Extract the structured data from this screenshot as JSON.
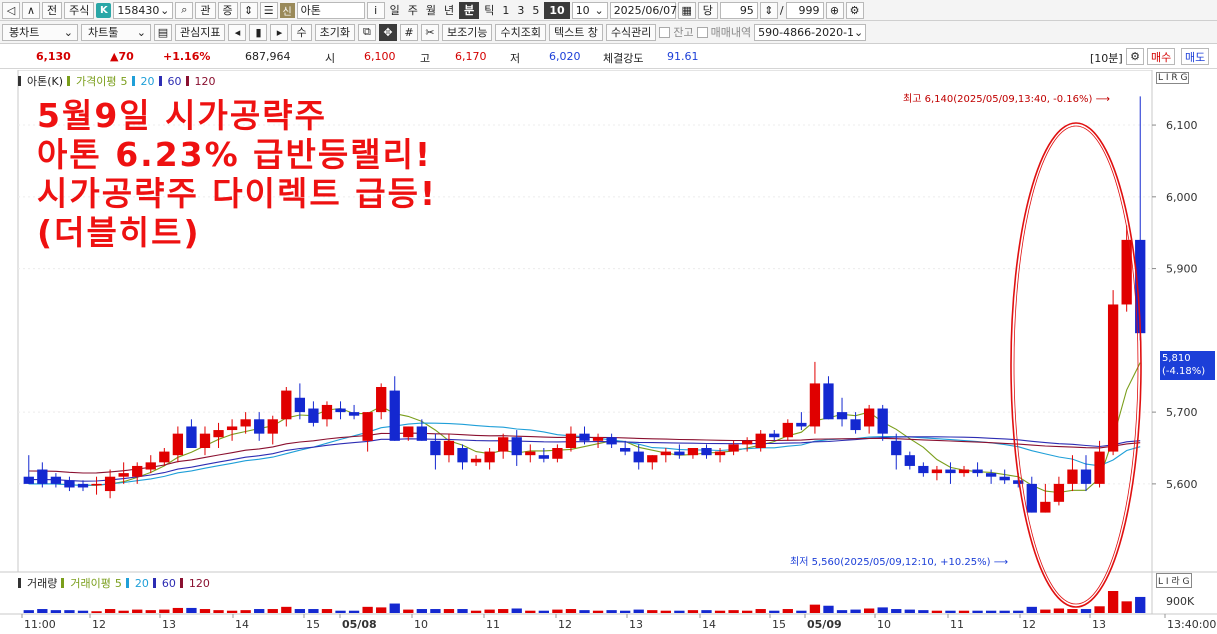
{
  "toolbar": {
    "prev_label": "전",
    "market_label": "주식",
    "k_badge": "K",
    "code": "158430",
    "gwan_label": "관",
    "jeung_label": "증",
    "sin_badge": "신",
    "stock_name": "아톤",
    "info_label": "i",
    "period_day": "일",
    "period_week": "주",
    "period_month": "월",
    "period_year": "년",
    "period_minute": "분",
    "period_tick": "틱",
    "interval_1": "1",
    "interval_3": "3",
    "interval_5": "5",
    "interval_10": "10",
    "interval_select": "10",
    "date": "2025/06/07",
    "dang_label": "당",
    "count": "95",
    "slash": "/",
    "max_count": "999",
    "bong_chart_label": "봉차트",
    "chart_tool_label": "차트툴",
    "watch_indicator_label": "관심지표",
    "su_label": "수",
    "reset_label": "초기화",
    "aux_function_label": "보조기능",
    "index_query_label": "수치조회",
    "text_window_label": "텍스트 창",
    "formula_mgmt_label": "수식관리",
    "balance_label": "잔고",
    "trade_history_label": "매매내역",
    "account": "590-4866-2020-1"
  },
  "quote": {
    "price": "6,130",
    "change": "▲70",
    "change_pct": "+1.16%",
    "volume": "687,964",
    "open_label": "시",
    "open": "6,100",
    "high_label": "고",
    "high": "6,170",
    "low_label": "저",
    "low": "6,020",
    "strength_label": "체결강도",
    "strength": "91.61",
    "period_tag": "[10분]",
    "buy_label": "매수",
    "sell_label": "매도"
  },
  "legend": {
    "stock": "아톤(K)",
    "ma_title": "가격이평",
    "ma5": "5",
    "ma20": "20",
    "ma60": "60",
    "ma120": "120",
    "vol_title": "거래량",
    "vol_ma_title": "거래이평",
    "vma5": "5",
    "vma20": "20",
    "vma60": "60",
    "vma120": "120"
  },
  "overlay": {
    "line1": "5월9일 시가공략주",
    "line2": "아톤 6.23% 급반등랠리!",
    "line3": "시가공략주 다이렉트 급등!",
    "line4": "(더블히트)"
  },
  "annotations": {
    "high": "최고 6,140(2025/05/09,13:40, -0.16%)",
    "low": "최저 5,560(2025/05/09,12:10, +10.25%)",
    "last_price": "5,810",
    "last_pct": "(-4.18%)",
    "right_tags": "L I R G",
    "vol_tags": "L I 라 G",
    "vol_axis": "900K"
  },
  "colors": {
    "up": "#e00000",
    "down": "#1428d0",
    "ma5": "#7a9e1b",
    "ma20": "#1f9fd8",
    "ma60": "#2d2db3",
    "ma120": "#8a1030",
    "overlay_text": "#ee1111"
  },
  "chart_data": {
    "type": "candlestick",
    "interval": "10분",
    "y_ticks": [
      "6,100",
      "6,000",
      "5,900",
      "5,700",
      "5,600"
    ],
    "ylim": [
      5480,
      6160
    ],
    "x_ticks": [
      "11:00",
      "12",
      "13",
      "14",
      "15",
      "05/08",
      "10",
      "11",
      "12",
      "13",
      "14",
      "15",
      "05/09",
      "10",
      "11",
      "12",
      "13",
      "13:40:00"
    ],
    "candles": [
      [
        5610,
        5640,
        5600,
        5600
      ],
      [
        5620,
        5630,
        5595,
        5600
      ],
      [
        5610,
        5615,
        5595,
        5600
      ],
      [
        5605,
        5610,
        5590,
        5595
      ],
      [
        5600,
        5605,
        5590,
        5595
      ],
      [
        5600,
        5610,
        5585,
        5600
      ],
      [
        5590,
        5620,
        5580,
        5610
      ],
      [
        5610,
        5630,
        5600,
        5615
      ],
      [
        5610,
        5630,
        5600,
        5625
      ],
      [
        5620,
        5640,
        5615,
        5630
      ],
      [
        5630,
        5650,
        5625,
        5645
      ],
      [
        5640,
        5680,
        5630,
        5670
      ],
      [
        5680,
        5690,
        5650,
        5650
      ],
      [
        5650,
        5680,
        5640,
        5670
      ],
      [
        5665,
        5685,
        5650,
        5675
      ],
      [
        5675,
        5690,
        5660,
        5680
      ],
      [
        5680,
        5700,
        5670,
        5690
      ],
      [
        5690,
        5700,
        5660,
        5670
      ],
      [
        5670,
        5695,
        5655,
        5690
      ],
      [
        5690,
        5735,
        5680,
        5730
      ],
      [
        5720,
        5740,
        5690,
        5700
      ],
      [
        5705,
        5715,
        5680,
        5685
      ],
      [
        5690,
        5715,
        5680,
        5710
      ],
      [
        5705,
        5715,
        5690,
        5700
      ],
      [
        5700,
        5710,
        5690,
        5695
      ],
      [
        5660,
        5700,
        5645,
        5700
      ],
      [
        5700,
        5740,
        5690,
        5735
      ],
      [
        5730,
        5750,
        5660,
        5660
      ],
      [
        5665,
        5680,
        5660,
        5680
      ],
      [
        5680,
        5690,
        5660,
        5660
      ],
      [
        5660,
        5670,
        5620,
        5640
      ],
      [
        5640,
        5670,
        5630,
        5660
      ],
      [
        5650,
        5655,
        5620,
        5630
      ],
      [
        5630,
        5640,
        5625,
        5635
      ],
      [
        5630,
        5650,
        5620,
        5645
      ],
      [
        5645,
        5670,
        5635,
        5665
      ],
      [
        5665,
        5675,
        5625,
        5640
      ],
      [
        5640,
        5655,
        5630,
        5645
      ],
      [
        5640,
        5650,
        5630,
        5635
      ],
      [
        5635,
        5655,
        5630,
        5650
      ],
      [
        5650,
        5680,
        5645,
        5670
      ],
      [
        5670,
        5680,
        5655,
        5660
      ],
      [
        5660,
        5670,
        5650,
        5665
      ],
      [
        5665,
        5670,
        5650,
        5655
      ],
      [
        5650,
        5660,
        5640,
        5645
      ],
      [
        5645,
        5655,
        5620,
        5630
      ],
      [
        5630,
        5640,
        5620,
        5640
      ],
      [
        5640,
        5650,
        5630,
        5645
      ],
      [
        5645,
        5655,
        5635,
        5640
      ],
      [
        5640,
        5650,
        5635,
        5650
      ],
      [
        5650,
        5655,
        5635,
        5640
      ],
      [
        5640,
        5650,
        5630,
        5645
      ],
      [
        5645,
        5660,
        5640,
        5655
      ],
      [
        5655,
        5665,
        5645,
        5660
      ],
      [
        5650,
        5675,
        5645,
        5670
      ],
      [
        5670,
        5675,
        5660,
        5665
      ],
      [
        5665,
        5690,
        5660,
        5685
      ],
      [
        5685,
        5700,
        5675,
        5680
      ],
      [
        5680,
        5770,
        5670,
        5740
      ],
      [
        5740,
        5750,
        5690,
        5690
      ],
      [
        5700,
        5720,
        5680,
        5690
      ],
      [
        5690,
        5700,
        5670,
        5675
      ],
      [
        5680,
        5710,
        5670,
        5705
      ],
      [
        5705,
        5710,
        5660,
        5670
      ],
      [
        5660,
        5670,
        5620,
        5640
      ],
      [
        5640,
        5645,
        5620,
        5625
      ],
      [
        5625,
        5630,
        5610,
        5615
      ],
      [
        5615,
        5625,
        5605,
        5620
      ],
      [
        5620,
        5630,
        5600,
        5615
      ],
      [
        5615,
        5625,
        5610,
        5620
      ],
      [
        5620,
        5630,
        5610,
        5615
      ],
      [
        5615,
        5620,
        5600,
        5610
      ],
      [
        5610,
        5620,
        5600,
        5605
      ],
      [
        5605,
        5615,
        5595,
        5600
      ],
      [
        5600,
        5610,
        5560,
        5560
      ],
      [
        5560,
        5600,
        5560,
        5575
      ],
      [
        5575,
        5610,
        5570,
        5600
      ],
      [
        5600,
        5640,
        5590,
        5620
      ],
      [
        5620,
        5640,
        5590,
        5600
      ],
      [
        5600,
        5660,
        5595,
        5645
      ],
      [
        5645,
        5870,
        5640,
        5850
      ],
      [
        5850,
        5960,
        5840,
        5940
      ],
      [
        5940,
        6140,
        5800,
        5810
      ]
    ],
    "series": [
      {
        "name": "5"
      },
      {
        "name": "20"
      },
      {
        "name": "60"
      },
      {
        "name": "120"
      }
    ]
  }
}
